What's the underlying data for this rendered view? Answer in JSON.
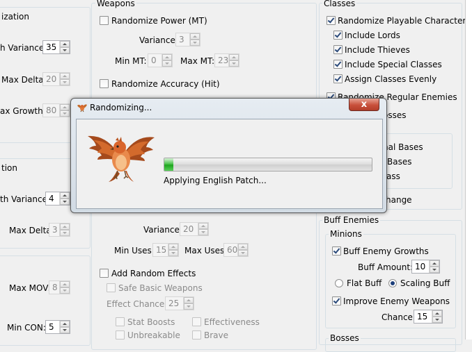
{
  "window": {
    "labels": {
      "ization": "ization",
      "h_variance": "h Variance:",
      "max_delta": "Max Delta:",
      "ax_growth": "ax Growth:",
      "tion": "tion",
      "th_variance": "th Variance:",
      "max_delta_2": "Max Delta:",
      "max_mov": "Max MOV:",
      "min_con": "Min CON:"
    },
    "values": {
      "h_variance": "35",
      "max_delta": "20",
      "ax_growth": "80",
      "th_variance": "4",
      "max_delta_2": "3",
      "max_mov": "8",
      "min_con": "5"
    }
  },
  "weapons": {
    "title": "Weapons",
    "randomize_power": "Randomize Power (MT)",
    "variance_label": "Variance:",
    "variance_value": "3",
    "min_mt_label": "Min MT:",
    "min_mt_value": "0",
    "max_mt_label": "Max MT:",
    "max_mt_value": "23",
    "randomize_accuracy": "Randomize Accuracy (Hit)",
    "uses_variance_label": "Variance:",
    "uses_variance_value": "20",
    "min_uses_label": "Min Uses:",
    "min_uses_value": "15",
    "max_uses_label": "Max Uses:",
    "max_uses_value": "60",
    "add_random_effects": "Add Random Effects",
    "safe_basic_weapons": "Safe Basic Weapons",
    "effect_chance_label": "Effect Chance:",
    "effect_chance_value": "25",
    "stat_boosts": "Stat Boosts",
    "effectiveness": "Effectiveness",
    "unbreakable": "Unbreakable",
    "brave": "Brave"
  },
  "classes": {
    "title": "Classes",
    "randomize_playable": "Randomize Playable Characters",
    "include_lords": "Include Lords",
    "include_thieves": "Include Thieves",
    "include_special": "Include Special Classes",
    "assign_evenly": "Assign Classes Evenly",
    "randomize_regular": "Randomize Regular Enemies",
    "bosses_partial": "osses",
    "nal_bases": "nal Bases",
    "bases": "Bases",
    "ass": "ass",
    "hange": "hange"
  },
  "buff": {
    "title": "Buff Enemies",
    "minions_title": "Minions",
    "buff_growths": "Buff Enemy Growths",
    "buff_amount_label": "Buff Amount:",
    "buff_amount_value": "10",
    "flat_buff": "Flat Buff",
    "scaling_buff": "Scaling Buff",
    "improve_weapons": "Improve Enemy Weapons",
    "chance_label": "Chance:",
    "chance_value": "15",
    "bosses_title": "Bosses"
  },
  "dialog": {
    "title": "Randomizing...",
    "close_label": "x",
    "status": "Applying English Patch...",
    "progress": 0.045,
    "accent": "#1ea51e"
  }
}
